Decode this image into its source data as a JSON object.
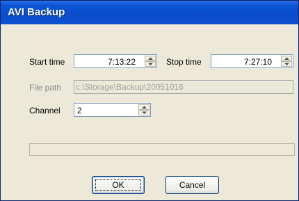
{
  "window": {
    "title": "AVI Backup"
  },
  "form": {
    "start_time": {
      "label": "Start time",
      "value": "7:13:22"
    },
    "stop_time": {
      "label": "Stop time",
      "value": "7:27:10"
    },
    "file_path": {
      "label": "File path",
      "value": "c:\\Storage\\Backup\\20051016"
    },
    "channel": {
      "label": "Channel",
      "value": "2"
    }
  },
  "progress": {
    "fraction": 0
  },
  "buttons": {
    "ok_label": "OK",
    "cancel_label": "Cancel"
  },
  "colors": {
    "titlebar": "#0a4ccc",
    "window_bg": "#ece9d8",
    "progress_fill": "#3fae3f"
  }
}
